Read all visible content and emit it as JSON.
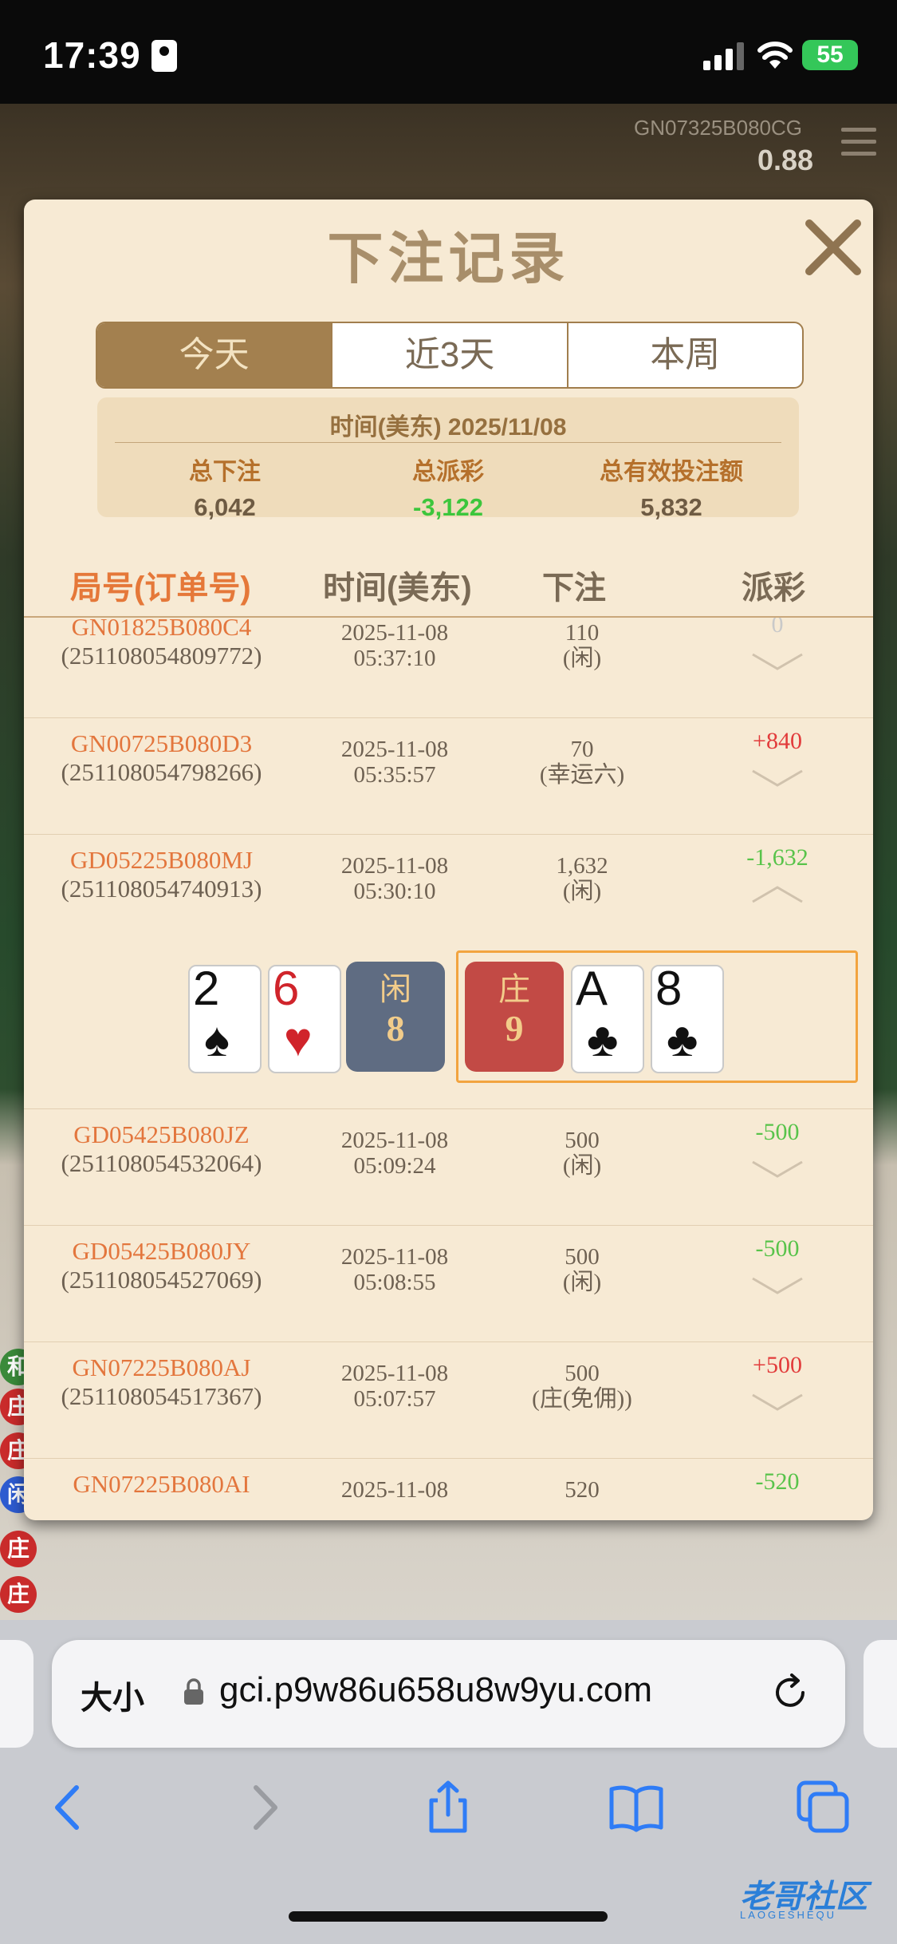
{
  "status_bar": {
    "time": "17:39",
    "battery": "55"
  },
  "game": {
    "table_id": "GN07325B080CG",
    "odds": "0.88"
  },
  "bead_road": [
    "和",
    "庄",
    "庄",
    "闲",
    "庄",
    "庄"
  ],
  "modal": {
    "title": "下注记录",
    "tabs": [
      {
        "label": "今天",
        "active": true
      },
      {
        "label": "近3天",
        "active": false
      },
      {
        "label": "本周",
        "active": false
      }
    ],
    "summary": {
      "date_label": "时间(美东)",
      "date": "2025/11/08",
      "total_bet_label": "总下注",
      "total_bet": "6,042",
      "total_payout_label": "总派彩",
      "total_payout": "-3,122",
      "valid_bet_label": "总有效投注额",
      "valid_bet": "5,832"
    },
    "columns": [
      "局号(订单号)",
      "时间(美东)",
      "下注",
      "派彩"
    ],
    "records": [
      {
        "round": "GN01825B080C4",
        "order": "(251108054809772)",
        "date": "2025-11-08",
        "time": "05:37:10",
        "amount": "110",
        "bet_type": "(闲)",
        "payout": "0",
        "expanded": false
      },
      {
        "round": "GN00725B080D3",
        "order": "(251108054798266)",
        "date": "2025-11-08",
        "time": "05:35:57",
        "amount": "70",
        "bet_type": "(幸运六)",
        "payout": "+840",
        "expanded": false
      },
      {
        "round": "GD05225B080MJ",
        "order": "(251108054740913)",
        "date": "2025-11-08",
        "time": "05:30:10",
        "amount": "1,632",
        "bet_type": "(闲)",
        "payout": "-1,632",
        "expanded": true
      },
      {
        "round": "GD05425B080JZ",
        "order": "(251108054532064)",
        "date": "2025-11-08",
        "time": "05:09:24",
        "amount": "500",
        "bet_type": "(闲)",
        "payout": "-500",
        "expanded": false
      },
      {
        "round": "GD05425B080JY",
        "order": "(251108054527069)",
        "date": "2025-11-08",
        "time": "05:08:55",
        "amount": "500",
        "bet_type": "(闲)",
        "payout": "-500",
        "expanded": false
      },
      {
        "round": "GN07225B080AJ",
        "order": "(251108054517367)",
        "date": "2025-11-08",
        "time": "05:07:57",
        "amount": "500",
        "bet_type": "(庄(免佣))",
        "payout": "+500",
        "expanded": false
      },
      {
        "round": "GN07225B080AI",
        "order": "",
        "date": "2025-11-08",
        "time": "",
        "amount": "520",
        "bet_type": "",
        "payout": "-520",
        "expanded": false
      }
    ],
    "detail": {
      "player_cards": [
        {
          "rank": "2",
          "suit": "♠"
        },
        {
          "rank": "6",
          "suit": "♥"
        }
      ],
      "player_label": "闲",
      "player_score": "8",
      "banker_label": "庄",
      "banker_score": "9",
      "banker_cards": [
        {
          "rank": "A",
          "suit": "♣"
        },
        {
          "rank": "8",
          "suit": "♣"
        }
      ]
    }
  },
  "browser": {
    "size_label": "大小",
    "url": "gci.p9w86u658u8w9yu.com"
  },
  "watermark": {
    "text": "老哥社区",
    "sub": "LAOGESHEQU"
  },
  "colors": {
    "accent": "#a3804f",
    "positive": "#e23b3b",
    "negative": "#58c34a",
    "link": "#e3763d"
  }
}
